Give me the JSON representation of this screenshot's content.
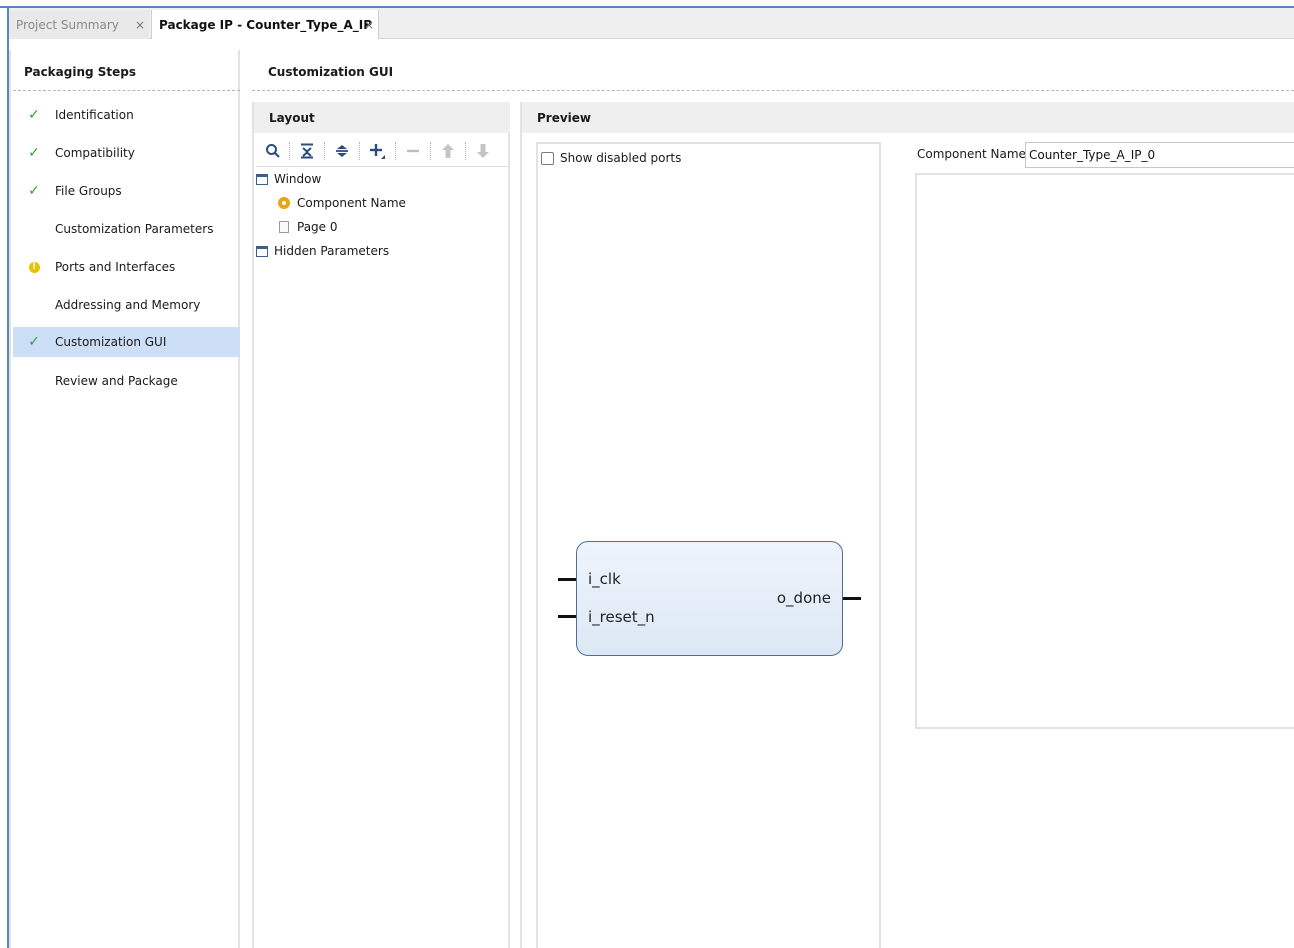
{
  "tabs": [
    {
      "label": "Project Summary",
      "active": false
    },
    {
      "label": "Package IP - Counter_Type_A_IP",
      "active": true
    }
  ],
  "tab_close_glyph": "×",
  "packaging_steps": {
    "title": "Packaging Steps",
    "items": [
      {
        "label": "Identification",
        "status": "check"
      },
      {
        "label": "Compatibility",
        "status": "check"
      },
      {
        "label": "File Groups",
        "status": "check"
      },
      {
        "label": "Customization Parameters",
        "status": "none"
      },
      {
        "label": "Ports and Interfaces",
        "status": "warning"
      },
      {
        "label": "Addressing and Memory",
        "status": "none"
      },
      {
        "label": "Customization GUI",
        "status": "check",
        "selected": true
      },
      {
        "label": "Review and Package",
        "status": "none"
      }
    ]
  },
  "main": {
    "title": "Customization GUI",
    "layout": {
      "title": "Layout",
      "toolbar": [
        "search-icon",
        "collapse-all-icon",
        "expand-all-icon",
        "add-icon",
        "remove-icon",
        "move-up-icon",
        "move-down-icon"
      ],
      "tree": [
        {
          "label": "Window",
          "icon": "window-icon",
          "level": 0
        },
        {
          "label": "Component Name",
          "icon": "gear-icon",
          "level": 1
        },
        {
          "label": "Page 0",
          "icon": "page-icon",
          "level": 1
        },
        {
          "label": "Hidden Parameters",
          "icon": "window-icon",
          "level": 0
        }
      ]
    },
    "preview": {
      "title": "Preview",
      "show_disabled_ports_label": "Show disabled ports",
      "show_disabled_ports_checked": false,
      "block": {
        "inputs": [
          "i_clk",
          "i_reset_n"
        ],
        "outputs": [
          "o_done"
        ]
      },
      "component_name_label": "Component Name",
      "component_name_value": "Counter_Type_A_IP_0"
    }
  }
}
